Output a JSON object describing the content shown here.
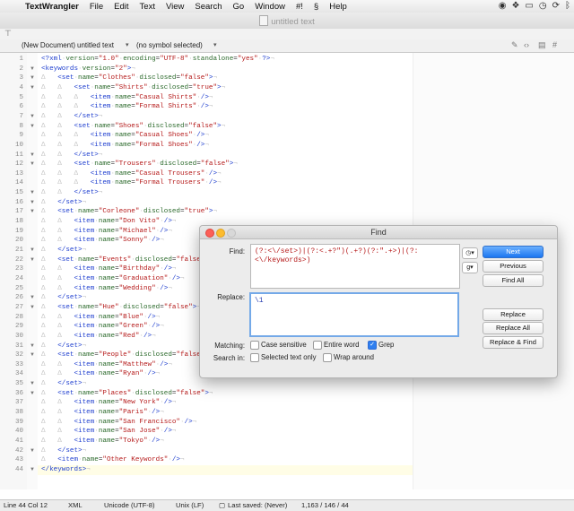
{
  "menubar": {
    "apple": "",
    "items": [
      "TextWrangler",
      "File",
      "Edit",
      "Text",
      "View",
      "Search",
      "Go",
      "Window",
      "#!",
      "Help"
    ],
    "script_icon": "script-icon",
    "right_icons": [
      "adobe-cc-icon",
      "dropbox-icon",
      "airplay-icon",
      "time-machine-icon",
      "sync-icon",
      "bluetooth-icon"
    ]
  },
  "window": {
    "title": "untitled text"
  },
  "sidebar": {
    "document_label": "(New Document)"
  },
  "navbar": {
    "file_name": "untitled text",
    "symbol": "(no symbol selected)"
  },
  "editor": {
    "current_line": 44,
    "lines": [
      "<?xml version=\"1.0\" encoding=\"UTF-8\" standalone=\"yes\" ?>",
      "<keywords version=\"2\">",
      "\t<set name=\"Clothes\" disclosed=\"false\">",
      "\t\t<set name=\"Shirts\" disclosed=\"true\">",
      "\t\t\t<item name=\"Casual Shirts\" />",
      "\t\t\t<item name=\"Formal Shirts\" />",
      "\t\t</set>",
      "\t\t<set name=\"Shoes\" disclosed=\"false\">",
      "\t\t\t<item name=\"Casual Shoes\" />",
      "\t\t\t<item name=\"Formal Shoes\" />",
      "\t\t</set>",
      "\t\t<set name=\"Trousers\" disclosed=\"false\">",
      "\t\t\t<item name=\"Casual Trousers\" />",
      "\t\t\t<item name=\"Formal Trousers\" />",
      "\t\t</set>",
      "\t</set>",
      "\t<set name=\"Corleone\" disclosed=\"true\">",
      "\t\t<item name=\"Don Vito\" />",
      "\t\t<item name=\"Michael\" />",
      "\t\t<item name=\"Sonny\" />",
      "\t</set>",
      "\t<set name=\"Events\" disclosed=\"false\">",
      "\t\t<item name=\"Birthday\" />",
      "\t\t<item name=\"Graduation\" />",
      "\t\t<item name=\"Wedding\" />",
      "\t</set>",
      "\t<set name=\"Hue\" disclosed=\"false\">",
      "\t\t<item name=\"Blue\" />",
      "\t\t<item name=\"Green\" />",
      "\t\t<item name=\"Red\" />",
      "\t</set>",
      "\t<set name=\"People\" disclosed=\"false\">",
      "\t\t<item name=\"Matthew\" />",
      "\t\t<item name=\"Ryan\" />",
      "\t</set>",
      "\t<set name=\"Places\" disclosed=\"false\">",
      "\t\t<item name=\"New York\" />",
      "\t\t<item name=\"Paris\" />",
      "\t\t<item name=\"San Francisco\" />",
      "\t\t<item name=\"San Jose\" />",
      "\t\t<item name=\"Tokyo\" />",
      "\t</set>",
      "\t<item name=\"Other Keywords\" />",
      "</keywords>"
    ],
    "folds": {
      "2": "▼",
      "3": "▼",
      "4": "▼",
      "7": "▼",
      "8": "▼",
      "11": "▼",
      "12": "▼",
      "15": "▼",
      "16": "▼",
      "17": "▼",
      "21": "▼",
      "22": "▼",
      "26": "▼",
      "27": "▼",
      "31": "▼",
      "32": "▼",
      "35": "▼",
      "36": "▼",
      "42": "▼",
      "44": "▼"
    }
  },
  "find_dialog": {
    "title": "Find",
    "find_label": "Find:",
    "find_value": "(?:<\\/set>)|(?:<.+?\")(.+?)(?:\".+>)|(?:<\\/keywords>)",
    "replace_label": "Replace:",
    "replace_value": "\\1",
    "buttons": {
      "next": "Next",
      "previous": "Previous",
      "find_all": "Find All",
      "replace": "Replace",
      "replace_all": "Replace All",
      "replace_find": "Replace & Find"
    },
    "matching_label": "Matching:",
    "search_in_label": "Search in:",
    "options": {
      "case_sensitive": {
        "label": "Case sensitive",
        "checked": false
      },
      "entire_word": {
        "label": "Entire word",
        "checked": false
      },
      "grep": {
        "label": "Grep",
        "checked": true
      },
      "selected_text_only": {
        "label": "Selected text only",
        "checked": false
      },
      "wrap_around": {
        "label": "Wrap around",
        "checked": false
      }
    }
  },
  "status": {
    "position": "Line 44 Col 12",
    "language": "XML",
    "encoding": "Unicode (UTF-8)",
    "line_endings": "Unix (LF)",
    "last_saved": "Last saved: (Never)",
    "stats": "1,163 / 146 / 44"
  },
  "colors": {
    "tag": "#1f3fcf",
    "attr": "#2d6b2d",
    "string": "#b51a1a",
    "accent": "#1b76f0"
  }
}
